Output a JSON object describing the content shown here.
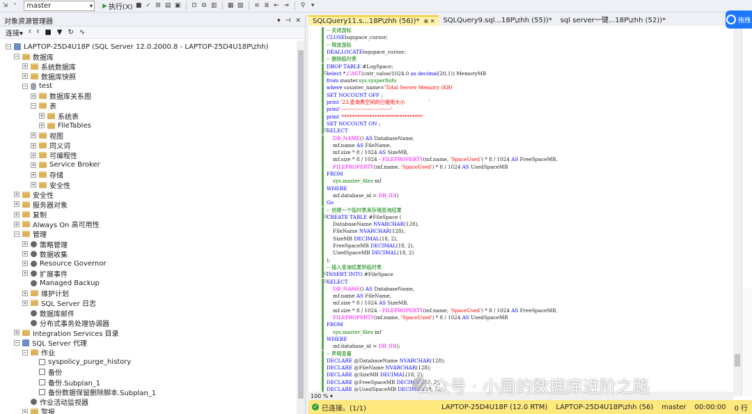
{
  "toolbar": {
    "db_value": "master",
    "execute_label": "执行(X)"
  },
  "object_explorer": {
    "title": "对象资源管理器",
    "connect_label": "连接",
    "nodes": [
      {
        "label": "LAPTOP-25D4U18P (SQL Server 12.0.2000.8 - LAPTOP-25D4U18P\\zhh)",
        "depth": 0,
        "exp": "⊟",
        "icon": "server"
      },
      {
        "label": "数据库",
        "depth": 1,
        "exp": "⊟",
        "icon": "folder"
      },
      {
        "label": "系统数据库",
        "depth": 2,
        "exp": "⊞",
        "icon": "folder"
      },
      {
        "label": "数据库快照",
        "depth": 2,
        "exp": "⊞",
        "icon": "folder"
      },
      {
        "label": "test",
        "depth": 2,
        "exp": "⊟",
        "icon": "db"
      },
      {
        "label": "数据库关系图",
        "depth": 3,
        "exp": "⊞",
        "icon": "folder"
      },
      {
        "label": "表",
        "depth": 3,
        "exp": "⊟",
        "icon": "folder"
      },
      {
        "label": "系统表",
        "depth": 4,
        "exp": "⊞",
        "icon": "folder"
      },
      {
        "label": "FileTables",
        "depth": 4,
        "exp": "⊞",
        "icon": "folder"
      },
      {
        "label": "视图",
        "depth": 3,
        "exp": "⊞",
        "icon": "folder"
      },
      {
        "label": "同义词",
        "depth": 3,
        "exp": "⊞",
        "icon": "folder"
      },
      {
        "label": "可编程性",
        "depth": 3,
        "exp": "⊞",
        "icon": "folder"
      },
      {
        "label": "Service Broker",
        "depth": 3,
        "exp": "⊞",
        "icon": "folder"
      },
      {
        "label": "存储",
        "depth": 3,
        "exp": "⊞",
        "icon": "folder"
      },
      {
        "label": "安全性",
        "depth": 3,
        "exp": "⊞",
        "icon": "folder"
      },
      {
        "label": "安全性",
        "depth": 1,
        "exp": "⊞",
        "icon": "folder"
      },
      {
        "label": "服务器对象",
        "depth": 1,
        "exp": "⊞",
        "icon": "folder"
      },
      {
        "label": "复制",
        "depth": 1,
        "exp": "⊞",
        "icon": "folder"
      },
      {
        "label": "Always On 高可用性",
        "depth": 1,
        "exp": "⊞",
        "icon": "folder"
      },
      {
        "label": "管理",
        "depth": 1,
        "exp": "⊟",
        "icon": "folder"
      },
      {
        "label": "策略管理",
        "depth": 2,
        "exp": "⊞",
        "icon": "gear"
      },
      {
        "label": "数据收集",
        "depth": 2,
        "exp": "⊞",
        "icon": "gear"
      },
      {
        "label": "Resource Governor",
        "depth": 2,
        "exp": "⊞",
        "icon": "gear"
      },
      {
        "label": "扩展事件",
        "depth": 2,
        "exp": "⊞",
        "icon": "gear"
      },
      {
        "label": "Managed Backup",
        "depth": 2,
        "exp": "",
        "icon": "gear"
      },
      {
        "label": "维护计划",
        "depth": 2,
        "exp": "⊞",
        "icon": "folder"
      },
      {
        "label": "SQL Server 日志",
        "depth": 2,
        "exp": "⊞",
        "icon": "folder"
      },
      {
        "label": "数据库邮件",
        "depth": 2,
        "exp": "",
        "icon": "gear"
      },
      {
        "label": "分布式事务处理协调器",
        "depth": 2,
        "exp": "",
        "icon": "gear"
      },
      {
        "label": "Integration Services 目录",
        "depth": 1,
        "exp": "⊞",
        "icon": "folder"
      },
      {
        "label": "SQL Server 代理",
        "depth": 1,
        "exp": "⊟",
        "icon": "server"
      },
      {
        "label": "作业",
        "depth": 2,
        "exp": "⊟",
        "icon": "folder"
      },
      {
        "label": "syspolicy_purge_history",
        "depth": 3,
        "exp": "",
        "icon": "job"
      },
      {
        "label": "备份",
        "depth": 3,
        "exp": "",
        "icon": "job"
      },
      {
        "label": "备份.Subplan_1",
        "depth": 3,
        "exp": "",
        "icon": "job"
      },
      {
        "label": "备份数据保留删除脚本.Subplan_1",
        "depth": 3,
        "exp": "",
        "icon": "job"
      },
      {
        "label": "作业活动监视器",
        "depth": 2,
        "exp": "",
        "icon": "gear"
      },
      {
        "label": "警报",
        "depth": 2,
        "exp": "⊞",
        "icon": "folder"
      }
    ]
  },
  "tabs": [
    {
      "label": "SQLQuery11.s...18P\\zhh (56))*",
      "active": true
    },
    {
      "label": "SQLQuery9.sql...18P\\zhh (55))*",
      "active": false
    },
    {
      "label": "sql server一键...18P\\zhh (52))*",
      "active": false
    }
  ],
  "code_lines": [
    [
      [
        "cm",
        "-- 关闭游标"
      ]
    ],
    [
      [
        "kw",
        "CLOSE"
      ],
      [
        "",
        "logspace_cursor;"
      ]
    ],
    [
      [
        "cm",
        "-- 释放游标"
      ]
    ],
    [
      [
        "kw",
        "DEALLOCATE"
      ],
      [
        "",
        "logspace_cursor;"
      ]
    ],
    [
      [
        "cm",
        "-- 删除临时表"
      ]
    ],
    [
      [
        "kw",
        "DROP TABLE"
      ],
      [
        "",
        " #LogSpace;"
      ]
    ],
    [
      [
        "kw",
        "select"
      ],
      [
        "",
        " *,"
      ],
      [
        "fn",
        "CAST"
      ],
      [
        "",
        "(cntr_value/1024.0 "
      ],
      [
        "kw",
        "as decimal"
      ],
      [
        "",
        "(20,1)) MemoryMB"
      ]
    ],
    [
      [
        "kw",
        "from"
      ],
      [
        "",
        " master."
      ],
      [
        "sys",
        "sys.sysperfinfo"
      ]
    ],
    [
      [
        "kw",
        "where"
      ],
      [
        "",
        " counter_name="
      ],
      [
        "str",
        "'Total Server Memory (KB)'"
      ]
    ],
    [
      [
        "kw",
        "SET NOCOUNT OFF"
      ],
      [
        "",
        " ;"
      ]
    ],
    [
      [
        "kw",
        "print"
      ],
      [
        "str",
        " '23.查询表空间的已使用大小               '"
      ]
    ],
    [
      [
        "kw",
        "print"
      ],
      [
        "str",
        "'------------------------------'"
      ]
    ],
    [
      [
        "kw",
        "print"
      ],
      [
        "str",
        " '********************************'"
      ]
    ],
    [
      [
        "kw",
        "SET NOCOUNT ON"
      ],
      [
        "",
        " ;"
      ]
    ],
    [
      [
        "kw",
        "SELECT"
      ]
    ],
    [
      [
        "",
        "    "
      ],
      [
        "fn",
        "DB_NAME"
      ],
      [
        "",
        "() "
      ],
      [
        "kw",
        "AS"
      ],
      [
        "",
        " DatabaseName,"
      ]
    ],
    [
      [
        "",
        "    mf.name "
      ],
      [
        "kw",
        "AS"
      ],
      [
        "",
        " FileName,"
      ]
    ],
    [
      [
        "",
        "    mf.size * 8 / 1024 "
      ],
      [
        "kw",
        "AS"
      ],
      [
        "",
        " SizeMB,"
      ]
    ],
    [
      [
        "",
        "    mf.size * 8 / 1024 - "
      ],
      [
        "fn",
        "FILEPROPERTY"
      ],
      [
        "",
        "(mf.name, "
      ],
      [
        "str",
        "'SpaceUsed'"
      ],
      [
        "",
        ") * 8 / 1024 "
      ],
      [
        "kw",
        "AS"
      ],
      [
        "",
        " FreeSpaceMB,"
      ]
    ],
    [
      [
        "",
        "    "
      ],
      [
        "fn",
        "FILEPROPERTY"
      ],
      [
        "",
        "(mf.name, "
      ],
      [
        "str",
        "'SpaceUsed'"
      ],
      [
        "",
        ") * 8 / 1024 "
      ],
      [
        "kw",
        "AS"
      ],
      [
        "",
        " UsedSpaceMB"
      ]
    ],
    [
      [
        "kw",
        "FROM"
      ]
    ],
    [
      [
        "",
        "    "
      ],
      [
        "sys",
        "sys.master_files"
      ],
      [
        "",
        " mf"
      ]
    ],
    [
      [
        "kw",
        "WHERE"
      ]
    ],
    [
      [
        "",
        "    mf.database_id = "
      ],
      [
        "fn",
        "DB_ID"
      ],
      [
        "",
        "()"
      ]
    ],
    [
      [
        "kw",
        "Go"
      ]
    ],
    [
      [
        "cm",
        "-- 创建一个临时表来存储查询结果"
      ]
    ],
    [
      [
        "kw",
        "CREATE TABLE"
      ],
      [
        "",
        " #FileSpace ("
      ]
    ],
    [
      [
        "",
        "    DatabaseName "
      ],
      [
        "kw",
        "NVARCHAR"
      ],
      [
        "",
        "(128),"
      ]
    ],
    [
      [
        "",
        "    FileName "
      ],
      [
        "kw",
        "NVARCHAR"
      ],
      [
        "",
        "(128),"
      ]
    ],
    [
      [
        "",
        "    SizeMB "
      ],
      [
        "kw",
        "DECIMAL"
      ],
      [
        "",
        "(18, 2),"
      ]
    ],
    [
      [
        "",
        "    FreeSpaceMB "
      ],
      [
        "kw",
        "DECIMAL"
      ],
      [
        "",
        "(18, 2),"
      ]
    ],
    [
      [
        "",
        "    UsedSpaceMB "
      ],
      [
        "kw",
        "DECIMAL"
      ],
      [
        "",
        "(18, 2)"
      ]
    ],
    [
      [
        "",
        ");"
      ]
    ],
    [
      [
        "cm",
        "-- 插入查询结果到临时表"
      ]
    ],
    [
      [
        "kw",
        "INSERT INTO"
      ],
      [
        "",
        " #FileSpace"
      ]
    ],
    [
      [
        "kw",
        "SELECT"
      ]
    ],
    [
      [
        "",
        "    "
      ],
      [
        "fn",
        "DB_NAME"
      ],
      [
        "",
        "() "
      ],
      [
        "kw",
        "AS"
      ],
      [
        "",
        " DatabaseName,"
      ]
    ],
    [
      [
        "",
        "    mf.name "
      ],
      [
        "kw",
        "AS"
      ],
      [
        "",
        " FileName,"
      ]
    ],
    [
      [
        "",
        "    mf.size * 8 / 1024 "
      ],
      [
        "kw",
        "AS"
      ],
      [
        "",
        " SizeMB,"
      ]
    ],
    [
      [
        "",
        "    mf.size * 8 / 1024 - "
      ],
      [
        "fn",
        "FILEPROPERTY"
      ],
      [
        "",
        "(mf.name, "
      ],
      [
        "str",
        "'SpaceUsed'"
      ],
      [
        "",
        ") * 8 / 1024 "
      ],
      [
        "kw",
        "AS"
      ],
      [
        "",
        " FreeSpaceMB,"
      ]
    ],
    [
      [
        "",
        "    "
      ],
      [
        "fn",
        "FILEPROPERTY"
      ],
      [
        "",
        "(mf.name, "
      ],
      [
        "str",
        "'SpaceUsed'"
      ],
      [
        "",
        ") * 8 / 1024 "
      ],
      [
        "kw",
        "AS"
      ],
      [
        "",
        " UsedSpaceMB"
      ]
    ],
    [
      [
        "kw",
        "FROM"
      ]
    ],
    [
      [
        "",
        "    "
      ],
      [
        "sys",
        "sys.master_files"
      ],
      [
        "",
        " mf"
      ]
    ],
    [
      [
        "kw",
        "WHERE"
      ]
    ],
    [
      [
        "",
        "    mf.database_id = "
      ],
      [
        "fn",
        "DB_ID"
      ],
      [
        "",
        "();"
      ]
    ],
    [
      [
        "cm",
        "-- 声明变量"
      ]
    ],
    [
      [
        "kw",
        "DECLARE"
      ],
      [
        "",
        " @DatabaseName "
      ],
      [
        "kw",
        "NVARCHAR"
      ],
      [
        "",
        "(128);"
      ]
    ],
    [
      [
        "kw",
        "DECLARE"
      ],
      [
        "",
        " @FileName "
      ],
      [
        "kw",
        "NVARCHAR"
      ],
      [
        "",
        "(128);"
      ]
    ],
    [
      [
        "kw",
        "DECLARE"
      ],
      [
        "",
        " @SizeMB "
      ],
      [
        "kw",
        "DECIMAL"
      ],
      [
        "",
        "(18, 2);"
      ]
    ],
    [
      [
        "kw",
        "DECLARE"
      ],
      [
        "",
        " @FreeSpaceMB "
      ],
      [
        "kw",
        "DECIMAL"
      ],
      [
        "",
        "(18, 2);"
      ]
    ],
    [
      [
        "kw",
        "DECLARE"
      ],
      [
        "",
        " @UsedSpaceMB "
      ],
      [
        "kw",
        "DECIMAL"
      ],
      [
        "",
        "(18, 2);"
      ]
    ]
  ],
  "zoom": "100 %",
  "status": {
    "connected": "已连接。(1/1)",
    "server": "LAPTOP-25D4U18P (12.0 RTM)",
    "user": "LAPTOP-25D4U18P\\zhh (56)",
    "db": "master",
    "time": "00:00:00",
    "rows": "0 行"
  },
  "cloud_label": "拖拽",
  "watermark": "公众号 · 小周的数据库进阶之路"
}
